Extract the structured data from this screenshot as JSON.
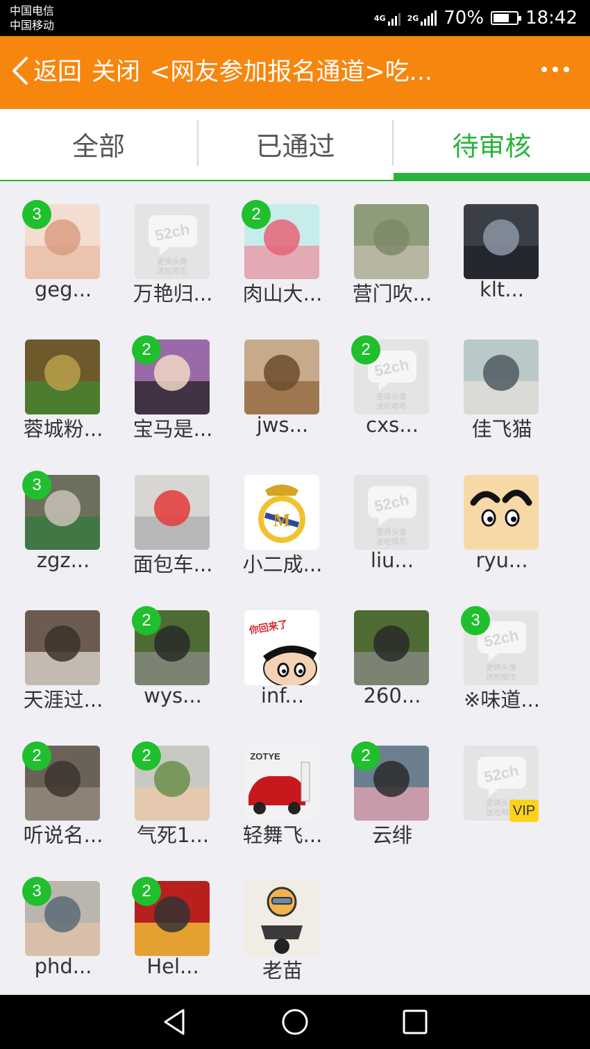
{
  "statusbar": {
    "carrier_1": "中国电信",
    "carrier_2": "中国移动",
    "net_1": "4G",
    "net_2": "2G",
    "battery": "70%",
    "time": "18:42"
  },
  "titlebar": {
    "back_label": "返回",
    "close_label": "关闭",
    "title": "<网友参加报名通道>吃..."
  },
  "tabs": [
    {
      "label": "全部"
    },
    {
      "label": "已通过"
    },
    {
      "label": "待审核"
    }
  ],
  "active_tab": "待审核",
  "colors": {
    "accent_orange": "#f7860e",
    "accent_green": "#2ab33c",
    "badge_green": "#1fbf2d",
    "vip_yellow": "#ffd21a"
  },
  "members": [
    {
      "name": "geg...",
      "badge": "3",
      "avatar": "baby-photo"
    },
    {
      "name": "万艳归...",
      "badge": "",
      "avatar": "default-52ch-avatar"
    },
    {
      "name": "肉山大...",
      "badge": "2",
      "avatar": "banknote-photo"
    },
    {
      "name": "营门吹...",
      "badge": "",
      "avatar": "street-cat-photo"
    },
    {
      "name": "klt...",
      "badge": "",
      "avatar": "steering-wheel-photo"
    },
    {
      "name": "蓉城粉...",
      "badge": "",
      "avatar": "dish-photo"
    },
    {
      "name": "宝马是...",
      "badge": "2",
      "avatar": "man-in-tuxedo-photo"
    },
    {
      "name": "jws...",
      "badge": "",
      "avatar": "grassland-photo"
    },
    {
      "name": "cxs...",
      "badge": "2",
      "avatar": "default-52ch-avatar"
    },
    {
      "name": "佳飞猫",
      "badge": "",
      "avatar": "hall-photo"
    },
    {
      "name": "zgz...",
      "badge": "3",
      "avatar": "child-bus-photo"
    },
    {
      "name": "面包车...",
      "badge": "",
      "avatar": "minivan-photo"
    },
    {
      "name": "小二成...",
      "badge": "",
      "avatar": "real-madrid-logo"
    },
    {
      "name": "liu...",
      "badge": "",
      "avatar": "default-52ch-avatar"
    },
    {
      "name": "ryu...",
      "badge": "",
      "avatar": "cartoon-eyebrows"
    },
    {
      "name": "天涯过...",
      "badge": "",
      "avatar": "husky-photo"
    },
    {
      "name": "wys...",
      "badge": "2",
      "avatar": "koala-photo"
    },
    {
      "name": "inf...",
      "badge": "",
      "avatar": "crayon-shin-chan",
      "avatar_text": "你回来了"
    },
    {
      "name": "260...",
      "badge": "",
      "avatar": "koala-photo"
    },
    {
      "name": "※味道...",
      "badge": "3",
      "avatar": "default-52ch-avatar"
    },
    {
      "name": "听说名...",
      "badge": "2",
      "avatar": "otter-photo"
    },
    {
      "name": "气死1...",
      "badge": "2",
      "avatar": "toddler-photo"
    },
    {
      "name": "轻舞飞...",
      "badge": "",
      "avatar": "zotye-car-photo",
      "avatar_text": "ZOTYE"
    },
    {
      "name": "云绯",
      "badge": "2",
      "avatar": "man-pink-shirt-photo"
    },
    {
      "name": "",
      "badge": "",
      "avatar": "default-52ch-avatar",
      "vip": "VIP"
    },
    {
      "name": "phd...",
      "badge": "3",
      "avatar": "man-cap-photo"
    },
    {
      "name": "Hel...",
      "badge": "2",
      "avatar": "minion-photo"
    },
    {
      "name": "老苗",
      "badge": "",
      "avatar": "cartoon-cat-motorbike"
    }
  ],
  "default_avatar": {
    "logo": "52ch",
    "caption_1": "更换头像",
    "caption_2": "送吃喝币"
  },
  "navbar": {
    "back": "back-triangle-icon",
    "home": "home-circle-icon",
    "recents": "recents-square-icon"
  }
}
